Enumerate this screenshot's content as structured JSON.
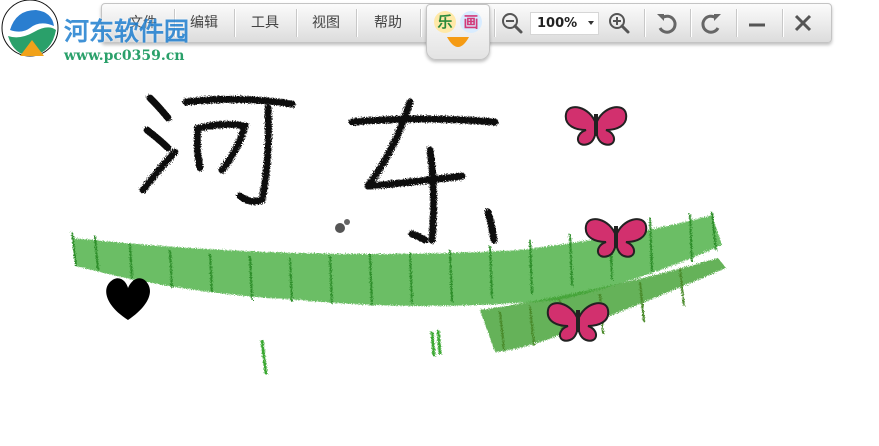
{
  "watermark": {
    "title": "河东软件园",
    "url": "www.pc0359.cn"
  },
  "toolbar": {
    "menu": [
      {
        "label": "文件"
      },
      {
        "label": "编辑"
      },
      {
        "label": "工具"
      },
      {
        "label": "视图"
      },
      {
        "label": "帮助"
      }
    ],
    "zoom_value": "100%",
    "logo_chars": [
      "乐",
      "画"
    ]
  },
  "canvas": {
    "drawn_text": "河东"
  },
  "colors": {
    "grass": "#3aa832",
    "ink": "#111111",
    "butterfly": "#d2306e",
    "watermark_blue": "#1f7fd0",
    "watermark_green": "#2aa06a"
  }
}
